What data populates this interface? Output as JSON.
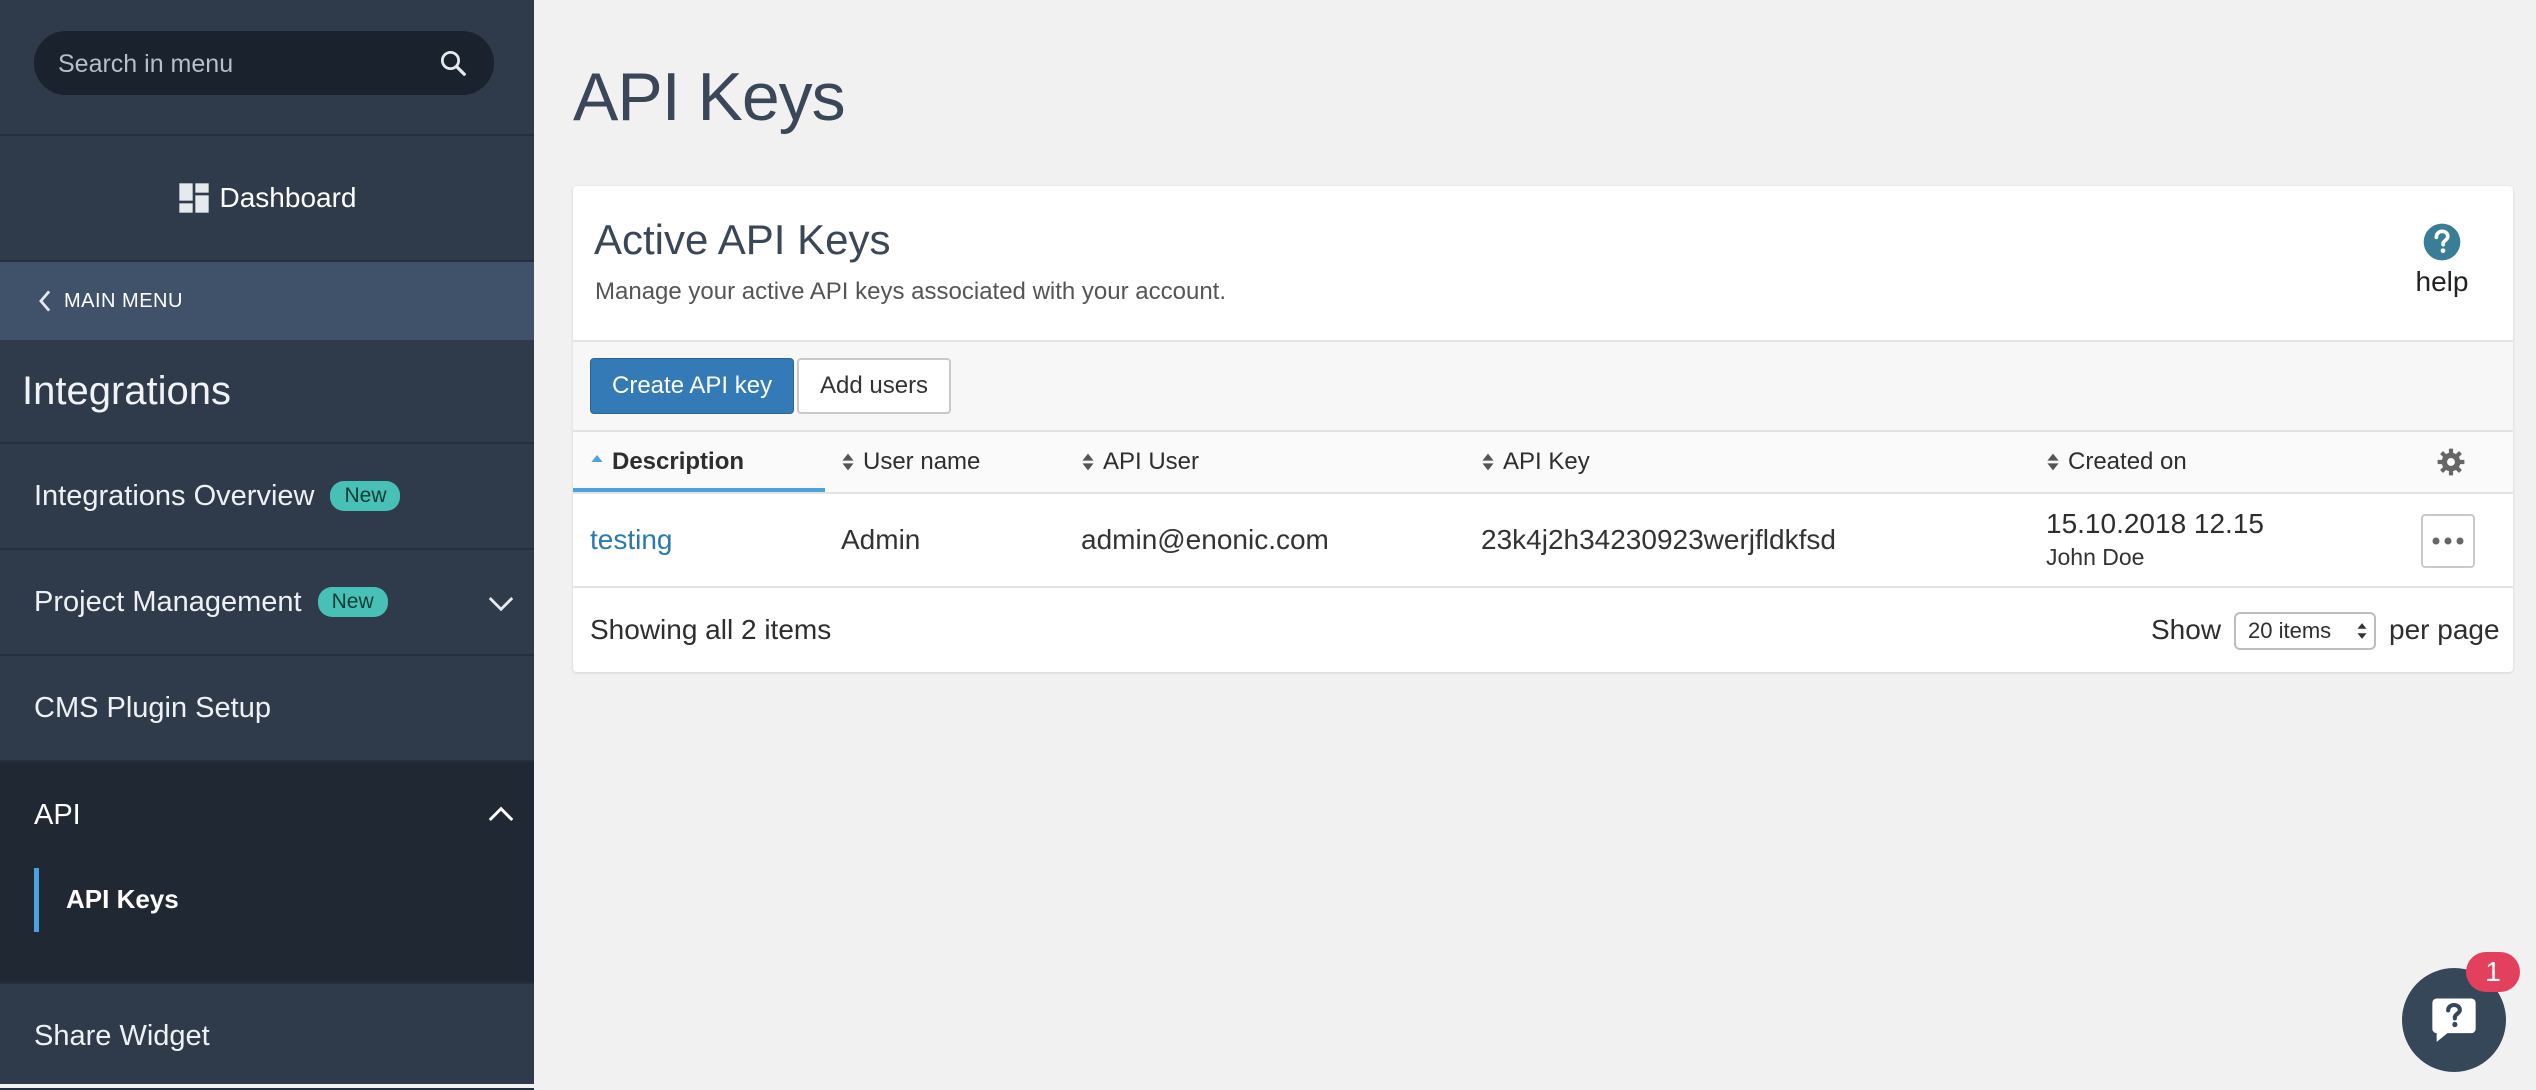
{
  "sidebar": {
    "search_placeholder": "Search in menu",
    "dashboard_label": "Dashboard",
    "main_menu_label": "MAIN MENU",
    "section_title": "Integrations",
    "items": [
      {
        "label": "Integrations Overview",
        "badge": "New"
      },
      {
        "label": "Project Management",
        "badge": "New"
      },
      {
        "label": "CMS Plugin Setup"
      },
      {
        "label": "API"
      },
      {
        "label": "API Keys"
      },
      {
        "label": "Share Widget"
      }
    ]
  },
  "main": {
    "page_title": "API Keys",
    "card": {
      "title": "Active API Keys",
      "subtitle": "Manage your active API keys associated with your account.",
      "help_label": "help"
    },
    "toolbar": {
      "create_label": "Create API key",
      "add_users_label": "Add users"
    },
    "table": {
      "columns": [
        "Description",
        "User name",
        "API User",
        "API Key",
        "Created on"
      ],
      "rows": [
        {
          "description": "testing",
          "user_name": "Admin",
          "api_user": "admin@enonic.com",
          "api_key": "23k4j2h34230923werjfldkfsd",
          "created_date": "15.10.2018 12.15",
          "created_by": "John Doe"
        }
      ]
    },
    "footer": {
      "showing": "Showing all 2 items",
      "show_label": "Show",
      "per_page_value": "20 items",
      "per_page_label": "per page"
    }
  },
  "chat": {
    "badge_count": "1"
  },
  "colors": {
    "sidebar_bg": "#2f3b4a",
    "accent": "#337ab7",
    "badge": "#47c1b6",
    "notification": "#e2405c"
  }
}
